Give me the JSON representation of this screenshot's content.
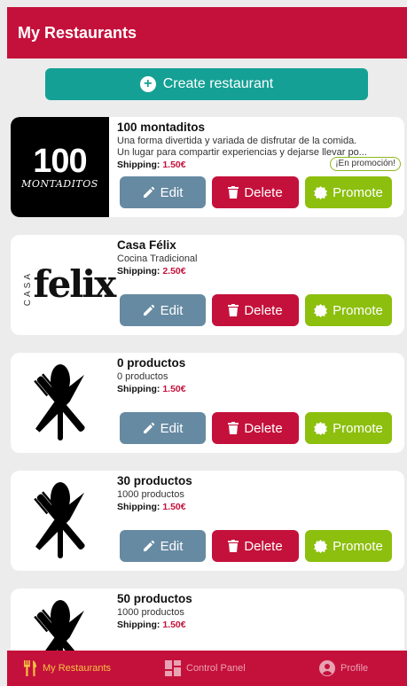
{
  "header": {
    "title": "My Restaurants"
  },
  "create_button": {
    "label": "Create restaurant",
    "icon": "plus-circle-icon"
  },
  "actions": {
    "edit": "Edit",
    "delete": "Delete",
    "promote": "Promote"
  },
  "restaurants": [
    {
      "name": "100 montaditos",
      "description_line1": "Una forma divertida y variada de disfrutar de la comida.",
      "description_line2": "Un lugar para compartir experiencias y dejarse llevar po...",
      "shipping_label": "Shipping:",
      "shipping_price": "1.50€",
      "promo_badge": "¡En promoción!",
      "logo_text_top": "100",
      "logo_text_bottom": "MONTADITOS"
    },
    {
      "name": "Casa Félix",
      "description_line1": "Cocina Tradicional",
      "shipping_label": "Shipping:",
      "shipping_price": "2.50€",
      "logo_text_side": "CASA",
      "logo_text_main": "felix"
    },
    {
      "name": "0 productos",
      "description_line1": "0 productos",
      "shipping_label": "Shipping:",
      "shipping_price": "1.50€"
    },
    {
      "name": "30 productos",
      "description_line1": "1000 productos",
      "shipping_label": "Shipping:",
      "shipping_price": "1.50€"
    },
    {
      "name": "50 productos",
      "description_line1": "1000 productos",
      "shipping_label": "Shipping:",
      "shipping_price": "1.50€"
    }
  ],
  "tabs": [
    {
      "label": "My Restaurants",
      "icon": "fork-knife-icon",
      "active": true
    },
    {
      "label": "Control Panel",
      "icon": "dashboard-icon",
      "active": false
    },
    {
      "label": "Profile",
      "icon": "user-circle-icon",
      "active": false
    }
  ],
  "colors": {
    "brand": "#c4113b",
    "create": "#14a095",
    "edit": "#668aa2",
    "delete": "#c4113b",
    "promote": "#8cbf0e",
    "active_tab": "#f3c242"
  }
}
